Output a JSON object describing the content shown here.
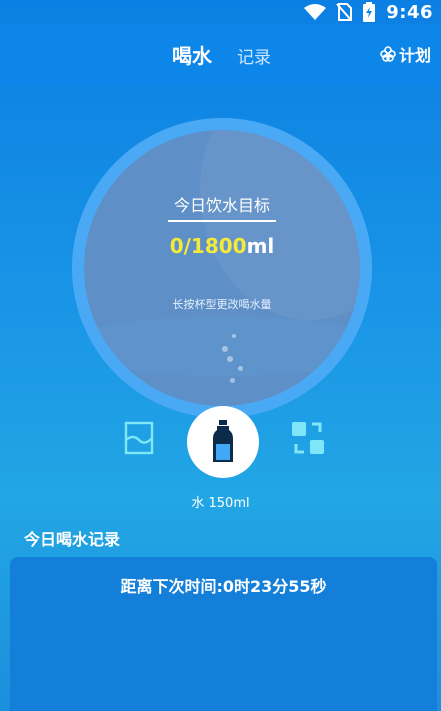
{
  "status_bar": {
    "time": "9:46"
  },
  "header": {
    "tab_main": "喝水",
    "tab_record": "记录",
    "plan_label": "计划"
  },
  "goal": {
    "title": "今日饮水目标",
    "current": "0",
    "separator": "/",
    "target": "1800",
    "unit": "ml",
    "hint": "长按杯型更改喝水量"
  },
  "cup": {
    "label": "水 150ml"
  },
  "records": {
    "title": "今日喝水记录",
    "countdown": "距离下次时间:0时23分55秒"
  },
  "colors": {
    "accent_yellow": "#f3ea3a",
    "cup_icon_cyan": "#7fe7f7",
    "header_blue": "#0d86ea"
  }
}
